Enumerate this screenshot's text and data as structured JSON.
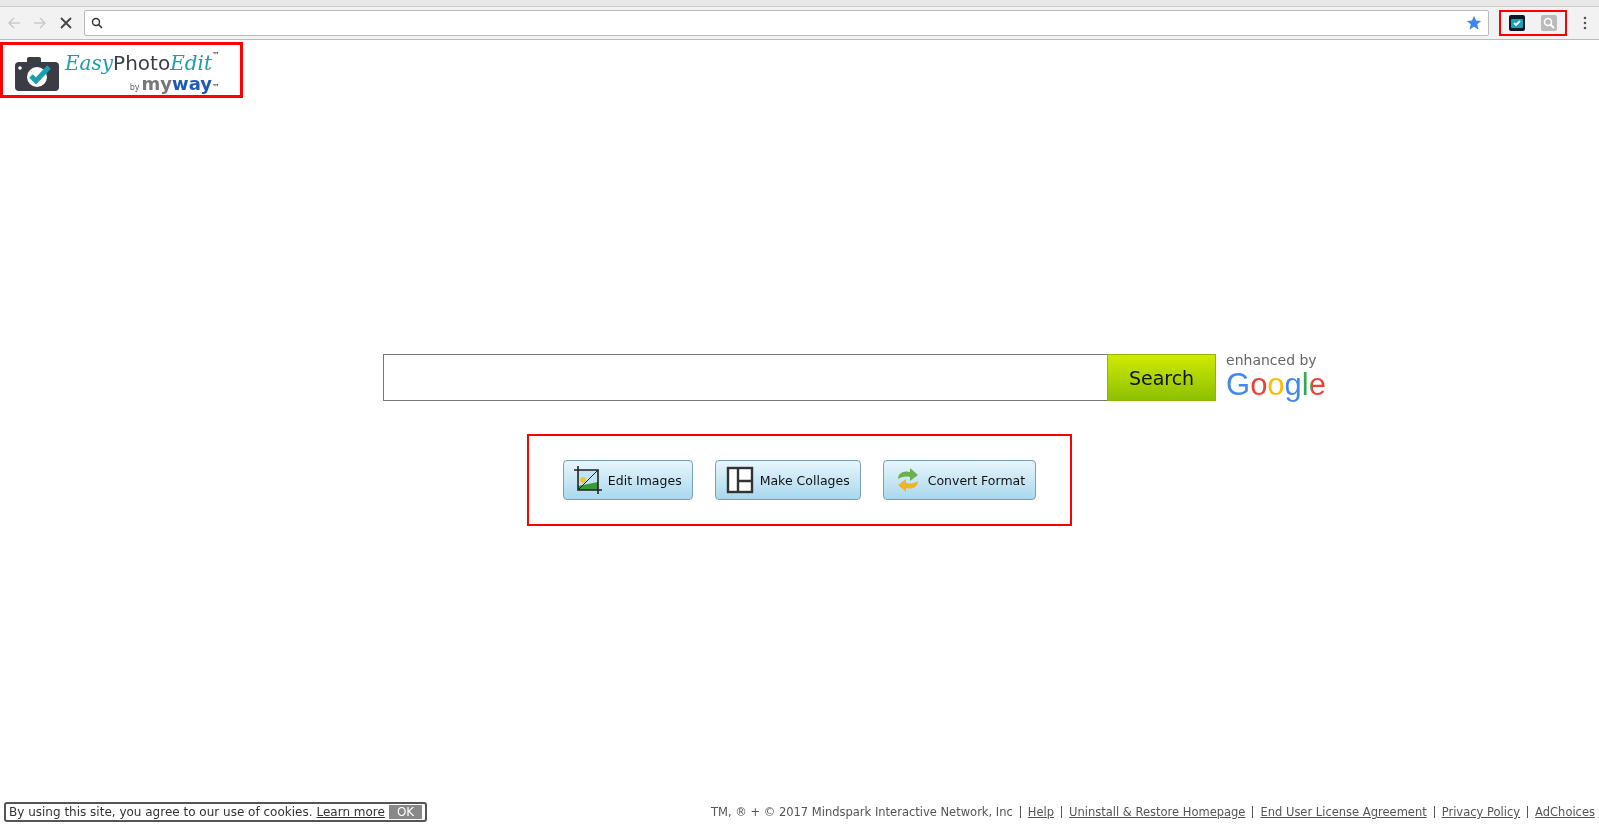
{
  "browser": {
    "extensions": [
      {
        "kind": "camera"
      },
      {
        "kind": "search"
      }
    ]
  },
  "logo": {
    "easy": "Easy",
    "photo": "Photo",
    "edit": "Edit",
    "tm": "™",
    "by": "by",
    "my": "my",
    "way": "way",
    "way_tm": "™"
  },
  "search": {
    "button": "Search",
    "enhanced_by": "enhanced by",
    "google": "Google"
  },
  "tools": [
    {
      "label": "Edit Images",
      "kind": "edit"
    },
    {
      "label": "Make Collages",
      "kind": "collage"
    },
    {
      "label": "Convert Format",
      "kind": "convert"
    }
  ],
  "cookie_bar": {
    "text": "By using this site, you agree to our use of cookies.",
    "link": "Learn more",
    "ok": "OK"
  },
  "footer": {
    "copyright": "TM, ® + © 2017 Mindspark Interactive Network, Inc",
    "links": [
      "Help",
      "Uninstall & Restore Homepage",
      "End User License Agreement",
      "Privacy Policy",
      "AdChoices"
    ]
  }
}
